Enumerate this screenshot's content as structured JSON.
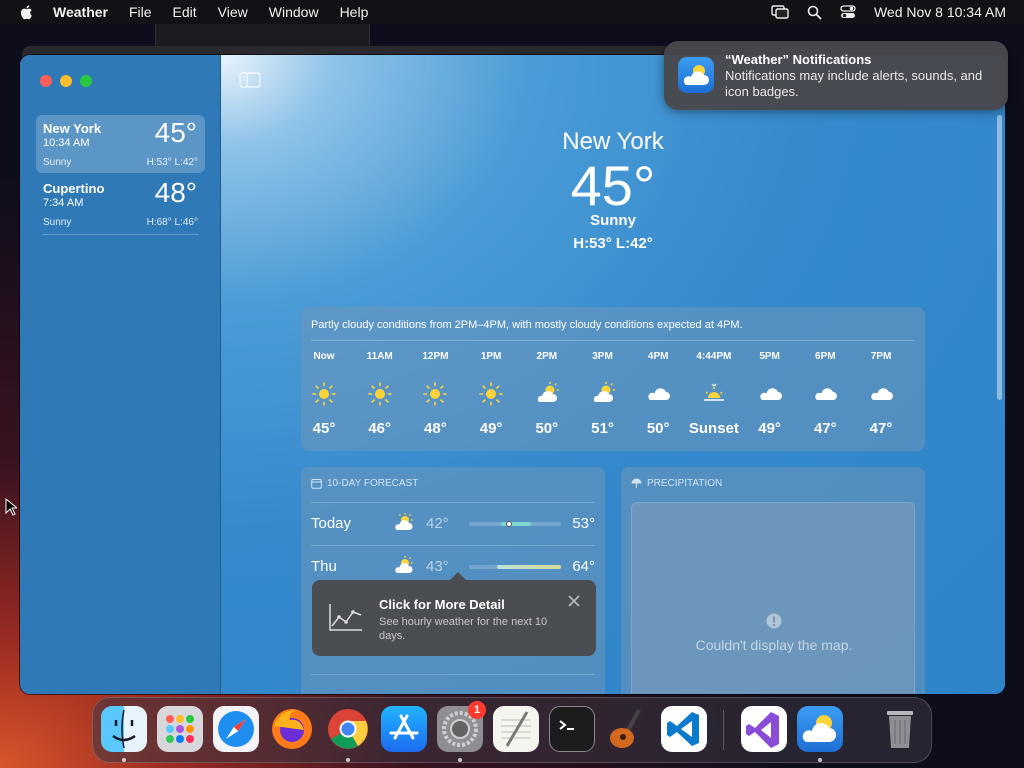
{
  "menubar": {
    "app_name": "Weather",
    "items": [
      "File",
      "Edit",
      "View",
      "Window",
      "Help"
    ],
    "datetime": "Wed Nov 8  10:34 AM"
  },
  "sidebar": {
    "cities": [
      {
        "name": "New York",
        "time": "10:34 AM",
        "temp": "45°",
        "condition": "Sunny",
        "hilo": "H:53°  L:42°"
      },
      {
        "name": "Cupertino",
        "time": "7:34 AM",
        "temp": "48°",
        "condition": "Sunny",
        "hilo": "H:68°  L:46°"
      }
    ]
  },
  "hero": {
    "city": "New York",
    "temp": "45°",
    "condition": "Sunny",
    "hilo": "H:53°  L:42°"
  },
  "hourly": {
    "summary": "Partly cloudy conditions from 2PM–4PM, with mostly cloudy conditions expected at 4PM.",
    "hours": [
      {
        "label": "Now",
        "icon": "sun-icon",
        "temp": "45°"
      },
      {
        "label": "11AM",
        "icon": "sun-icon",
        "temp": "46°"
      },
      {
        "label": "12PM",
        "icon": "sun-icon",
        "temp": "48°"
      },
      {
        "label": "1PM",
        "icon": "sun-icon",
        "temp": "49°"
      },
      {
        "label": "2PM",
        "icon": "partly-cloudy-icon",
        "temp": "50°"
      },
      {
        "label": "3PM",
        "icon": "partly-cloudy-icon",
        "temp": "51°"
      },
      {
        "label": "4PM",
        "icon": "cloud-icon",
        "temp": "50°"
      },
      {
        "label": "4:44PM",
        "icon": "sunset-icon",
        "temp": "Sunset"
      },
      {
        "label": "5PM",
        "icon": "cloud-icon",
        "temp": "49°"
      },
      {
        "label": "6PM",
        "icon": "cloud-icon",
        "temp": "47°"
      },
      {
        "label": "7PM",
        "icon": "cloud-icon",
        "temp": "47°"
      }
    ]
  },
  "forecast": {
    "header": "10-DAY FORECAST",
    "days": [
      {
        "day": "Today",
        "lo": "42°",
        "hi": "53°"
      },
      {
        "day": "Thu",
        "lo": "43°",
        "hi": "64°"
      }
    ]
  },
  "tooltip": {
    "title": "Click for More Detail",
    "body": "See hourly weather for the next 10 days."
  },
  "precipitation": {
    "header": "PRECIPITATION",
    "message": "Couldn't display the map."
  },
  "notification": {
    "title": "“Weather” Notifications",
    "body": "Notifications may include alerts, sounds, and icon badges."
  },
  "dock": {
    "badge_count": "1",
    "apps": [
      "Finder",
      "Launchpad",
      "Safari",
      "Firefox",
      "Chrome",
      "App Store",
      "System Settings",
      "TextEdit",
      "Terminal",
      "GarageBand",
      "VS Code",
      "Visual Studio",
      "Weather",
      "Trash"
    ]
  },
  "colors": {
    "sky": "#3589cc",
    "sidebar": "#2f79b7",
    "sun": "#ffd43a",
    "temp_bar": "#7dd6d0"
  }
}
